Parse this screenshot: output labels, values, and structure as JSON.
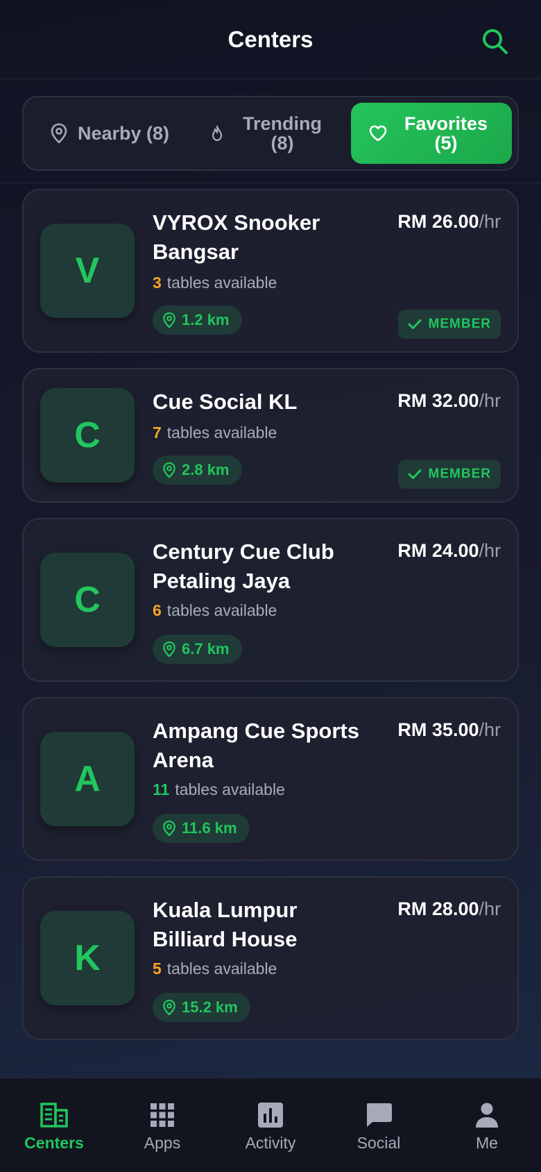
{
  "header": {
    "title": "Centers",
    "search_icon": "search-icon"
  },
  "tabs": [
    {
      "label": "Nearby (8)",
      "icon": "map-pin-icon",
      "active": false
    },
    {
      "label": "Trending (8)",
      "icon": "flame-icon",
      "active": false
    },
    {
      "label": "Favorites (5)",
      "icon": "heart-icon",
      "active": true
    }
  ],
  "centers": [
    {
      "initial": "V",
      "name": "VYROX Snooker Bangsar",
      "price": "RM 26.00",
      "unit": "/hr",
      "tables_count": "3",
      "tables_text": "tables available",
      "distance": "1.2 km",
      "member_label": "MEMBER"
    },
    {
      "initial": "C",
      "name": "Cue Social KL",
      "price": "RM 32.00",
      "unit": "/hr",
      "tables_count": "7",
      "tables_text": "tables available",
      "distance": "2.8 km",
      "member_label": "MEMBER"
    },
    {
      "initial": "C",
      "name": "Century Cue Club Petaling Jaya",
      "price": "RM 24.00",
      "unit": "/hr",
      "tables_count": "6",
      "tables_text": "tables available",
      "distance": "6.7 km"
    },
    {
      "initial": "A",
      "name": "Ampang Cue Sports Arena",
      "price": "RM 35.00",
      "unit": "/hr",
      "tables_count": "11",
      "tables_text": "tables available",
      "distance": "11.6 km"
    },
    {
      "initial": "K",
      "name": "Kuala Lumpur Billiard House",
      "price": "RM 28.00",
      "unit": "/hr",
      "tables_count": "5",
      "tables_text": "tables available",
      "distance": "15.2 km"
    }
  ],
  "nav": [
    {
      "label": "Centers",
      "icon": "building-icon",
      "active": true
    },
    {
      "label": "Apps",
      "icon": "grid-icon",
      "active": false
    },
    {
      "label": "Activity",
      "icon": "bar-chart-icon",
      "active": false
    },
    {
      "label": "Social",
      "icon": "chat-bubble-icon",
      "active": false
    },
    {
      "label": "Me",
      "icon": "user-icon",
      "active": false
    }
  ],
  "colors": {
    "accent": "#22c55e",
    "amber": "#f5a524",
    "background": "#12151f"
  }
}
